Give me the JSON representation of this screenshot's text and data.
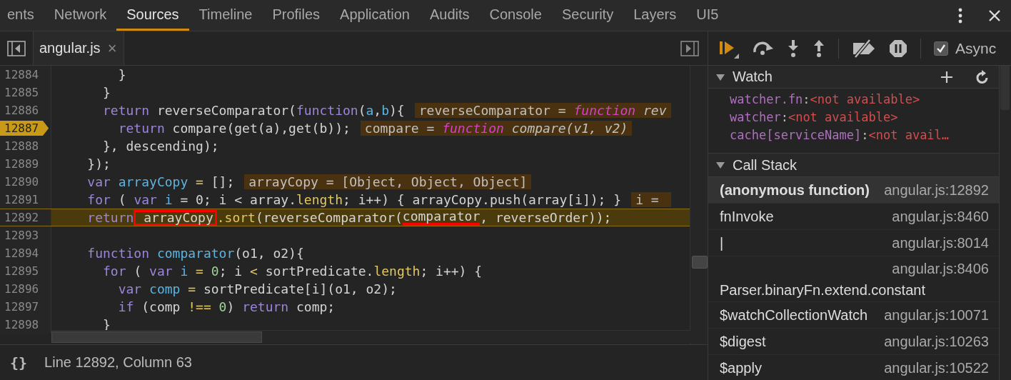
{
  "tabs": [
    {
      "label": "ents",
      "selected": false
    },
    {
      "label": "Network",
      "selected": false
    },
    {
      "label": "Sources",
      "selected": true
    },
    {
      "label": "Timeline",
      "selected": false
    },
    {
      "label": "Profiles",
      "selected": false
    },
    {
      "label": "Application",
      "selected": false
    },
    {
      "label": "Audits",
      "selected": false
    },
    {
      "label": "Console",
      "selected": false
    },
    {
      "label": "Security",
      "selected": false
    },
    {
      "label": "Layers",
      "selected": false
    },
    {
      "label": "UI5",
      "selected": false
    }
  ],
  "editor": {
    "file_tab": {
      "name": "angular.js",
      "close": "×"
    },
    "lines": [
      {
        "number": "12884",
        "breakpoint": false,
        "current": false,
        "tokens": [
          {
            "kind": "plain",
            "text": "        }"
          }
        ]
      },
      {
        "number": "12885",
        "breakpoint": false,
        "current": false,
        "tokens": [
          {
            "kind": "plain",
            "text": "      }"
          }
        ]
      },
      {
        "number": "12886",
        "breakpoint": false,
        "current": false,
        "tokens": [
          {
            "kind": "kw",
            "text": "      return"
          },
          {
            "kind": "plain",
            "text": " reverseComparator("
          },
          {
            "kind": "kw",
            "text": "function"
          },
          {
            "kind": "plain",
            "text": "("
          },
          {
            "kind": "var",
            "text": "a"
          },
          {
            "kind": "plain",
            "text": ","
          },
          {
            "kind": "var",
            "text": "b"
          },
          {
            "kind": "plain",
            "text": "){"
          }
        ],
        "inline": [
          {
            "kind": "plain",
            "text": "reverseComparator = "
          },
          {
            "kind": "fnkw",
            "text": "function"
          },
          {
            "kind": "italic",
            "text": " rev"
          }
        ]
      },
      {
        "number": "12887",
        "breakpoint": true,
        "current": false,
        "tokens": [
          {
            "kind": "kw",
            "text": "        return"
          },
          {
            "kind": "plain",
            "text": " compare(get(a),get(b));"
          }
        ],
        "inline": [
          {
            "kind": "plain",
            "text": "compare = "
          },
          {
            "kind": "fnkw",
            "text": "function"
          },
          {
            "kind": "italic",
            "text": " compare(v1, v2)"
          }
        ]
      },
      {
        "number": "12888",
        "breakpoint": false,
        "current": false,
        "tokens": [
          {
            "kind": "plain",
            "text": "      }, descending);"
          }
        ]
      },
      {
        "number": "12889",
        "breakpoint": false,
        "current": false,
        "tokens": [
          {
            "kind": "plain",
            "text": "    });"
          }
        ]
      },
      {
        "number": "12890",
        "breakpoint": false,
        "current": false,
        "tokens": [
          {
            "kind": "kw",
            "text": "    var"
          },
          {
            "kind": "var",
            "text": " arrayCopy"
          },
          {
            "kind": "op",
            "text": " ="
          },
          {
            "kind": "plain",
            "text": " [];"
          }
        ],
        "inline": [
          {
            "kind": "plain",
            "text": "arrayCopy = [Object, Object, Object]"
          }
        ]
      },
      {
        "number": "12891",
        "breakpoint": false,
        "current": false,
        "tokens": [
          {
            "kind": "kw",
            "text": "    for"
          },
          {
            "kind": "plain",
            "text": " ( "
          },
          {
            "kind": "decl",
            "keyword": "var",
            "name": "i"
          },
          {
            "kind": "plain",
            "text": " = 0; i < array."
          },
          {
            "kind": "prop",
            "text": "length"
          },
          {
            "kind": "plain",
            "text": "; i++) { arrayCopy.push(array[i]); }"
          }
        ],
        "inline": [
          {
            "kind": "plain",
            "text": "i = "
          }
        ]
      },
      {
        "number": "12892",
        "breakpoint": false,
        "current": true,
        "tokens": [
          {
            "kind": "kw",
            "text": "    return"
          },
          {
            "kind": "boxed",
            "text": " arrayCopy"
          },
          {
            "kind": "prop",
            "text": ".sort"
          },
          {
            "kind": "plain",
            "text": "(reverseComparator("
          },
          {
            "kind": "underlined",
            "text": "comparator"
          },
          {
            "kind": "plain",
            "text": ", reverseOrder));"
          }
        ]
      },
      {
        "number": "12893",
        "breakpoint": false,
        "current": false
      },
      {
        "number": "12894",
        "breakpoint": false,
        "current": false,
        "tokens": [
          {
            "kind": "kw",
            "text": "    function"
          },
          {
            "kind": "var",
            "text": " comparator"
          },
          {
            "kind": "plain",
            "text": "(o1, o2){"
          }
        ]
      },
      {
        "number": "12895",
        "breakpoint": false,
        "current": false,
        "tokens": [
          {
            "kind": "kw",
            "text": "      for"
          },
          {
            "kind": "plain",
            "text": " ( "
          },
          {
            "kind": "decl",
            "keyword": "var",
            "name": "i"
          },
          {
            "kind": "op",
            "text": " ="
          },
          {
            "kind": "num",
            "text": " 0"
          },
          {
            "kind": "plain",
            "text": "; i "
          },
          {
            "kind": "op",
            "text": "<"
          },
          {
            "kind": "plain",
            "text": " sortPredicate."
          },
          {
            "kind": "prop",
            "text": "length"
          },
          {
            "kind": "plain",
            "text": "; i++) {"
          }
        ]
      },
      {
        "number": "12896",
        "breakpoint": false,
        "current": false,
        "tokens": [
          {
            "kind": "kw",
            "text": "        var"
          },
          {
            "kind": "var",
            "text": " comp"
          },
          {
            "kind": "op",
            "text": " ="
          },
          {
            "kind": "plain",
            "text": " sortPredicate[i](o1, o2);"
          }
        ]
      },
      {
        "number": "12897",
        "breakpoint": false,
        "current": false,
        "tokens": [
          {
            "kind": "kw",
            "text": "        if"
          },
          {
            "kind": "plain",
            "text": " (comp "
          },
          {
            "kind": "op",
            "text": "!=="
          },
          {
            "kind": "num",
            "text": " 0"
          },
          {
            "kind": "plain",
            "text": ") "
          },
          {
            "kind": "kw",
            "text": "return"
          },
          {
            "kind": "plain",
            "text": " comp;"
          }
        ]
      },
      {
        "number": "12898",
        "breakpoint": false,
        "current": false,
        "tokens": [
          {
            "kind": "plain",
            "text": "      }"
          }
        ]
      }
    ]
  },
  "status_bar": {
    "pretty_print": "{}",
    "position": "Line 12892, Column 63"
  },
  "debugger": {
    "async": {
      "label": "Async",
      "checked": true
    },
    "watch": {
      "title": "Watch",
      "expanded": true,
      "items": [
        {
          "name": "watcher.fn",
          "separator": ":",
          "value": "<not available>"
        },
        {
          "name": "watcher",
          "separator": ":",
          "value": "<not available>"
        },
        {
          "name": "cache[serviceName]",
          "separator": ":",
          "value": "<not avail…"
        }
      ]
    },
    "call_stack": {
      "title": "Call Stack",
      "expanded": true,
      "frames": [
        {
          "name": "(anonymous function)",
          "location": "angular.js:12892",
          "selected": true
        },
        {
          "name": "fnInvoke",
          "location": "angular.js:8460",
          "selected": false
        },
        {
          "name": "|",
          "location": "angular.js:8014",
          "selected": false
        },
        {
          "name": "Parser.binaryFn.extend.constant",
          "location": "angular.js:8406",
          "selected": false
        },
        {
          "name": "$watchCollectionWatch",
          "location": "angular.js:10071",
          "selected": false
        },
        {
          "name": "$digest",
          "location": "angular.js:10263",
          "selected": false
        },
        {
          "name": "$apply",
          "location": "angular.js:10522",
          "selected": false
        }
      ]
    }
  }
}
